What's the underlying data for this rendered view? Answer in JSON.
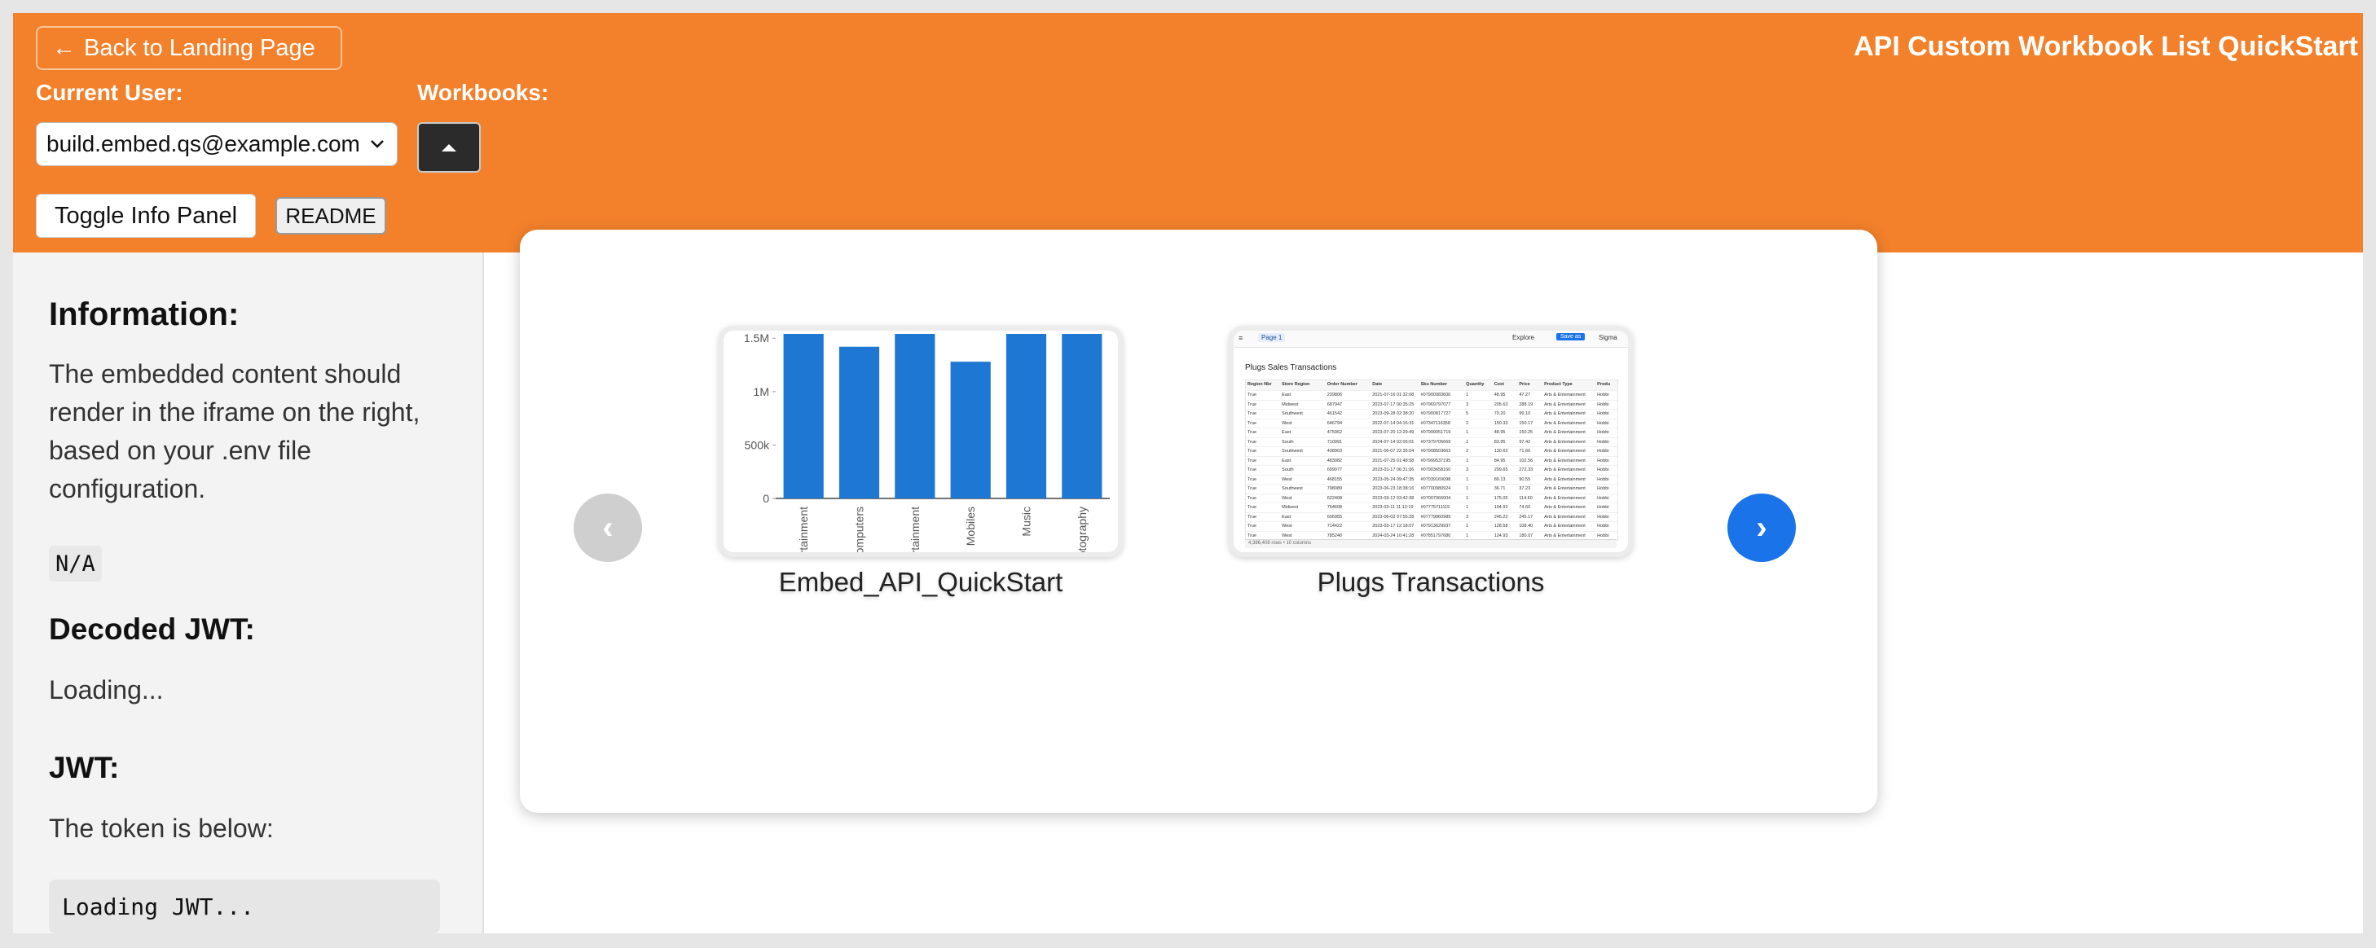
{
  "header": {
    "back_label": "Back to Landing Page",
    "app_title": "API Custom Workbook List QuickStart",
    "current_user_label": "Current User:",
    "workbooks_label": "Workbooks:",
    "selected_user": "build.embed.qs@example.com",
    "toggle_label": "Toggle Info Panel",
    "readme_label": "README",
    "accent_color": "#f3812b"
  },
  "info": {
    "information_heading": "Information:",
    "information_text": "The embedded content should render in the iframe on the right, based on your .env file configuration.",
    "na_code": "N/A",
    "decoded_heading": "Decoded JWT:",
    "decoded_text": "Loading...",
    "jwt_heading": "JWT:",
    "jwt_text": "The token is below:",
    "jwt_code": "Loading JWT..."
  },
  "carousel": {
    "prev_label": "‹",
    "next_label": "›",
    "workbooks": [
      {
        "name": "Embed_API_QuickStart"
      },
      {
        "name": "Plugs Transactions"
      }
    ]
  },
  "chart_data": {
    "type": "bar",
    "title": "",
    "xlabel": "",
    "ylabel": "",
    "y_tick_labels": [
      "0",
      "500k",
      "1M",
      "1.5M"
    ],
    "y_ticks": [
      0,
      500000,
      1000000,
      1500000
    ],
    "ylim": [
      0,
      1540000
    ],
    "categories": [
      "rtainment",
      "omputers",
      "rtainment",
      "Mobiles",
      "Music",
      "otography"
    ],
    "values": [
      1560000,
      1420000,
      1570000,
      1280000,
      1600000,
      1590000
    ],
    "bar_color": "#1f77d4",
    "grid": false
  },
  "sheet": {
    "title": "Plugs Sales Transactions",
    "page_tab": "Page 1",
    "explore": "Explore",
    "save_as": "Save as",
    "brand": "Sigma",
    "footer": "4,386,408 rows • 10 columns",
    "columns": [
      "Region Nbr",
      "Store Region",
      "Order Number",
      "Date",
      "Sku Number",
      "Quantity",
      "Cost",
      "Price",
      "Product Type",
      "Produ"
    ],
    "rows": [
      [
        "True",
        "East",
        "239806",
        "2021-07-16 01:32:08",
        "#07900083600",
        "1",
        "48.95",
        "47.27",
        "Arts & Entertainment",
        "Hobbi"
      ],
      [
        "True",
        "Midwest",
        "687947",
        "2023-07-17 00:35:25",
        "#07969797077",
        "3",
        "205.63",
        "288.19",
        "Arts & Entertainment",
        "Hobbi"
      ],
      [
        "True",
        "Southwest",
        "461542",
        "2023-09-28 02:38:20",
        "#07900817727",
        "5",
        "79.20",
        "99.10",
        "Arts & Entertainment",
        "Hobbi"
      ],
      [
        "True",
        "West",
        "646794",
        "2022-07-14 04:16:31",
        "#07347116358",
        "2",
        "150.33",
        "150.17",
        "Arts & Entertainment",
        "Hobbi"
      ],
      [
        "True",
        "East",
        "475962",
        "2023-07-20 12:29:49",
        "#07999051719",
        "1",
        "48.95",
        "150.25",
        "Arts & Entertainment",
        "Hobbi"
      ],
      [
        "True",
        "South",
        "710991",
        "2024-07-14 02:05:01",
        "#07379705669",
        "1",
        "83.95",
        "97.42",
        "Arts & Entertainment",
        "Hobbi"
      ],
      [
        "True",
        "Southwest",
        "438903",
        "2021-06-07 22:35:04",
        "#07908503663",
        "2",
        "130.62",
        "71.66",
        "Arts & Entertainment",
        "Hobbi"
      ],
      [
        "True",
        "East",
        "483082",
        "2021-07-25 01:48:58",
        "#07999537195",
        "1",
        "84.95",
        "102.56",
        "Arts & Entertainment",
        "Hobbi"
      ],
      [
        "True",
        "South",
        "699977",
        "2023-01-17 06:31:06",
        "#07903658160",
        "3",
        "299.65",
        "272.33",
        "Arts & Entertainment",
        "Hobbi"
      ],
      [
        "True",
        "West",
        "468155",
        "2023-05-24 09:47:35",
        "#07039169098",
        "1",
        "89.13",
        "90.55",
        "Arts & Entertainment",
        "Hobbi"
      ],
      [
        "True",
        "Southwest",
        "798089",
        "2023-06-23 18:38:16",
        "#07700980924",
        "1",
        "36.71",
        "37.23",
        "Arts & Entertainment",
        "Hobbi"
      ],
      [
        "True",
        "West",
        "622408",
        "2023-03-12 03:42:38",
        "#07007066004",
        "1",
        "175.05",
        "114.60",
        "Arts & Entertainment",
        "Hobbi"
      ],
      [
        "True",
        "Midwest",
        "754608",
        "2023-03-11 11:12:19",
        "#07775711119",
        "1",
        "104.92",
        "74.60",
        "Arts & Entertainment",
        "Hobbi"
      ],
      [
        "True",
        "East",
        "606955",
        "2023-06-02 07:55:28",
        "#07779860989",
        "3",
        "245.22",
        "245.17",
        "Arts & Entertainment",
        "Hobbi"
      ],
      [
        "True",
        "West",
        "714422",
        "2023-03-17 12:18:07",
        "#07913629937",
        "1",
        "128.58",
        "108.40",
        "Arts & Entertainment",
        "Hobbi"
      ],
      [
        "True",
        "West",
        "785240",
        "2024-03-24 10:41:28",
        "#07851797680",
        "1",
        "124.93",
        "180.07",
        "Arts & Entertainment",
        "Hobbi"
      ]
    ]
  }
}
